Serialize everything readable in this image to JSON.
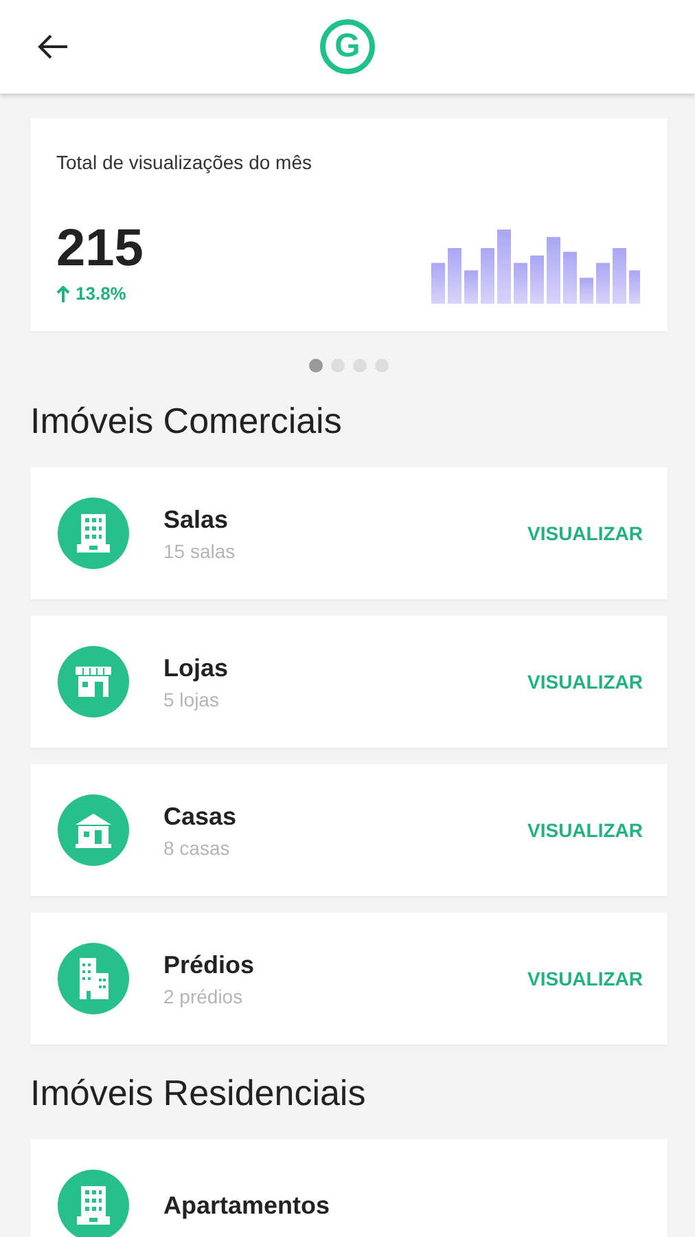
{
  "header": {
    "logo": "G"
  },
  "stats_card": {
    "title": "Total de visualizações do mês",
    "total": "215",
    "change": "13.8%"
  },
  "pager": [
    {
      "selected": true
    },
    {
      "selected": false
    },
    {
      "selected": false
    },
    {
      "selected": false
    }
  ],
  "sections": [
    {
      "title": "Imóveis Comerciais",
      "items": [
        {
          "name": "Salas",
          "count": "15 salas",
          "action": "VISUALIZAR"
        },
        {
          "name": "Lojas",
          "count": "5 lojas",
          "action": "VISUALIZAR"
        },
        {
          "name": "Casas",
          "count": "8 casas",
          "action": "VISUALIZAR"
        },
        {
          "name": "Prédios",
          "count": "2 prédios",
          "action": "VISUALIZAR"
        }
      ]
    },
    {
      "title": "Imóveis Residenciais",
      "items": [
        {
          "name": "Apartamentos"
        }
      ]
    }
  ]
}
